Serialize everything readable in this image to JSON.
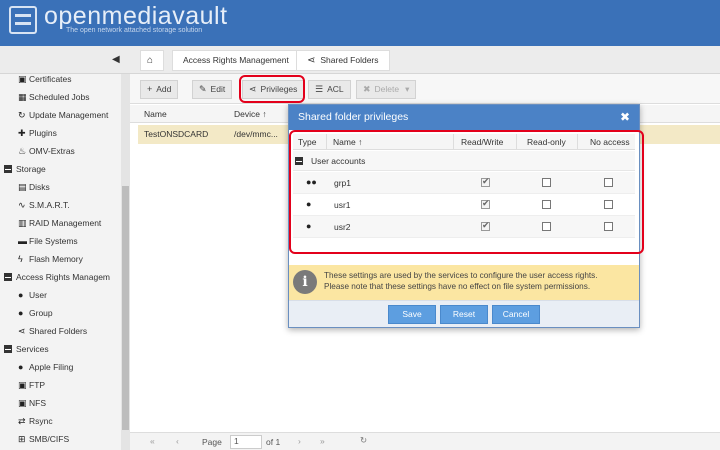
{
  "app": {
    "brand": "openmediavault",
    "tagline": "The open network attached storage solution"
  },
  "nav": {
    "tabs": [
      {
        "label": ""
      },
      {
        "label": "Access Rights Management"
      },
      {
        "label": "Shared Folders"
      }
    ]
  },
  "sidebar": {
    "items": [
      {
        "label": "Certificates",
        "icon": "certificate-icon"
      },
      {
        "label": "Scheduled Jobs",
        "icon": "calendar-icon"
      },
      {
        "label": "Update Management",
        "icon": "update-icon"
      },
      {
        "label": "Plugins",
        "icon": "puzzle-icon"
      },
      {
        "label": "OMV-Extras",
        "icon": "flame-icon"
      },
      {
        "label": "Storage",
        "type": "category"
      },
      {
        "label": "Disks",
        "icon": "disk-icon"
      },
      {
        "label": "S.M.A.R.T.",
        "icon": "pulse-icon"
      },
      {
        "label": "RAID Management",
        "icon": "raid-icon"
      },
      {
        "label": "File Systems",
        "icon": "folder-icon"
      },
      {
        "label": "Flash Memory",
        "icon": "bolt-icon"
      },
      {
        "label": "Access Rights Managem",
        "type": "category"
      },
      {
        "label": "User",
        "icon": "user-icon"
      },
      {
        "label": "Group",
        "icon": "group-icon"
      },
      {
        "label": "Shared Folders",
        "icon": "share-icon"
      },
      {
        "label": "Services",
        "type": "category"
      },
      {
        "label": "Apple Filing",
        "icon": "apple-icon"
      },
      {
        "label": "FTP",
        "icon": "ftp-icon"
      },
      {
        "label": "NFS",
        "icon": "nfs-icon"
      },
      {
        "label": "Rsync",
        "icon": "rsync-icon"
      },
      {
        "label": "SMB/CIFS",
        "icon": "windows-icon"
      }
    ]
  },
  "toolbar": {
    "add": "Add",
    "edit": "Edit",
    "privileges": "Privileges",
    "acl": "ACL",
    "delete": "Delete"
  },
  "grid": {
    "columns": [
      "Name",
      "Device"
    ],
    "rows": [
      {
        "name": "TestONSDCARD",
        "device": "/dev/mmc..."
      }
    ]
  },
  "paging": {
    "page_label": "Page",
    "page_value": "1",
    "of_label": "of 1"
  },
  "modal": {
    "title": "Shared folder privileges",
    "columns": {
      "type": "Type",
      "name": "Name",
      "rw": "Read/Write",
      "ro": "Read-only",
      "na": "No access"
    },
    "group_label": "User accounts",
    "rows": [
      {
        "icon": "group-icon",
        "name": "grp1",
        "rw": true,
        "ro": false,
        "na": false
      },
      {
        "icon": "user-icon",
        "name": "usr1",
        "rw": true,
        "ro": false,
        "na": false
      },
      {
        "icon": "user-icon",
        "name": "usr2",
        "rw": true,
        "ro": false,
        "na": false
      }
    ],
    "info_line1": "These settings are used by the services to configure the user access rights.",
    "info_line2": "Please note that these settings have no effect on file system permissions.",
    "buttons": {
      "save": "Save",
      "reset": "Reset",
      "cancel": "Cancel"
    }
  },
  "colors": {
    "header": "#3a71b8",
    "modal_title": "#4b82c6",
    "button": "#5d9ee0",
    "info_bg": "#fbe6a2",
    "selected_row": "#f3e9c6",
    "highlight": "#e3001b"
  }
}
